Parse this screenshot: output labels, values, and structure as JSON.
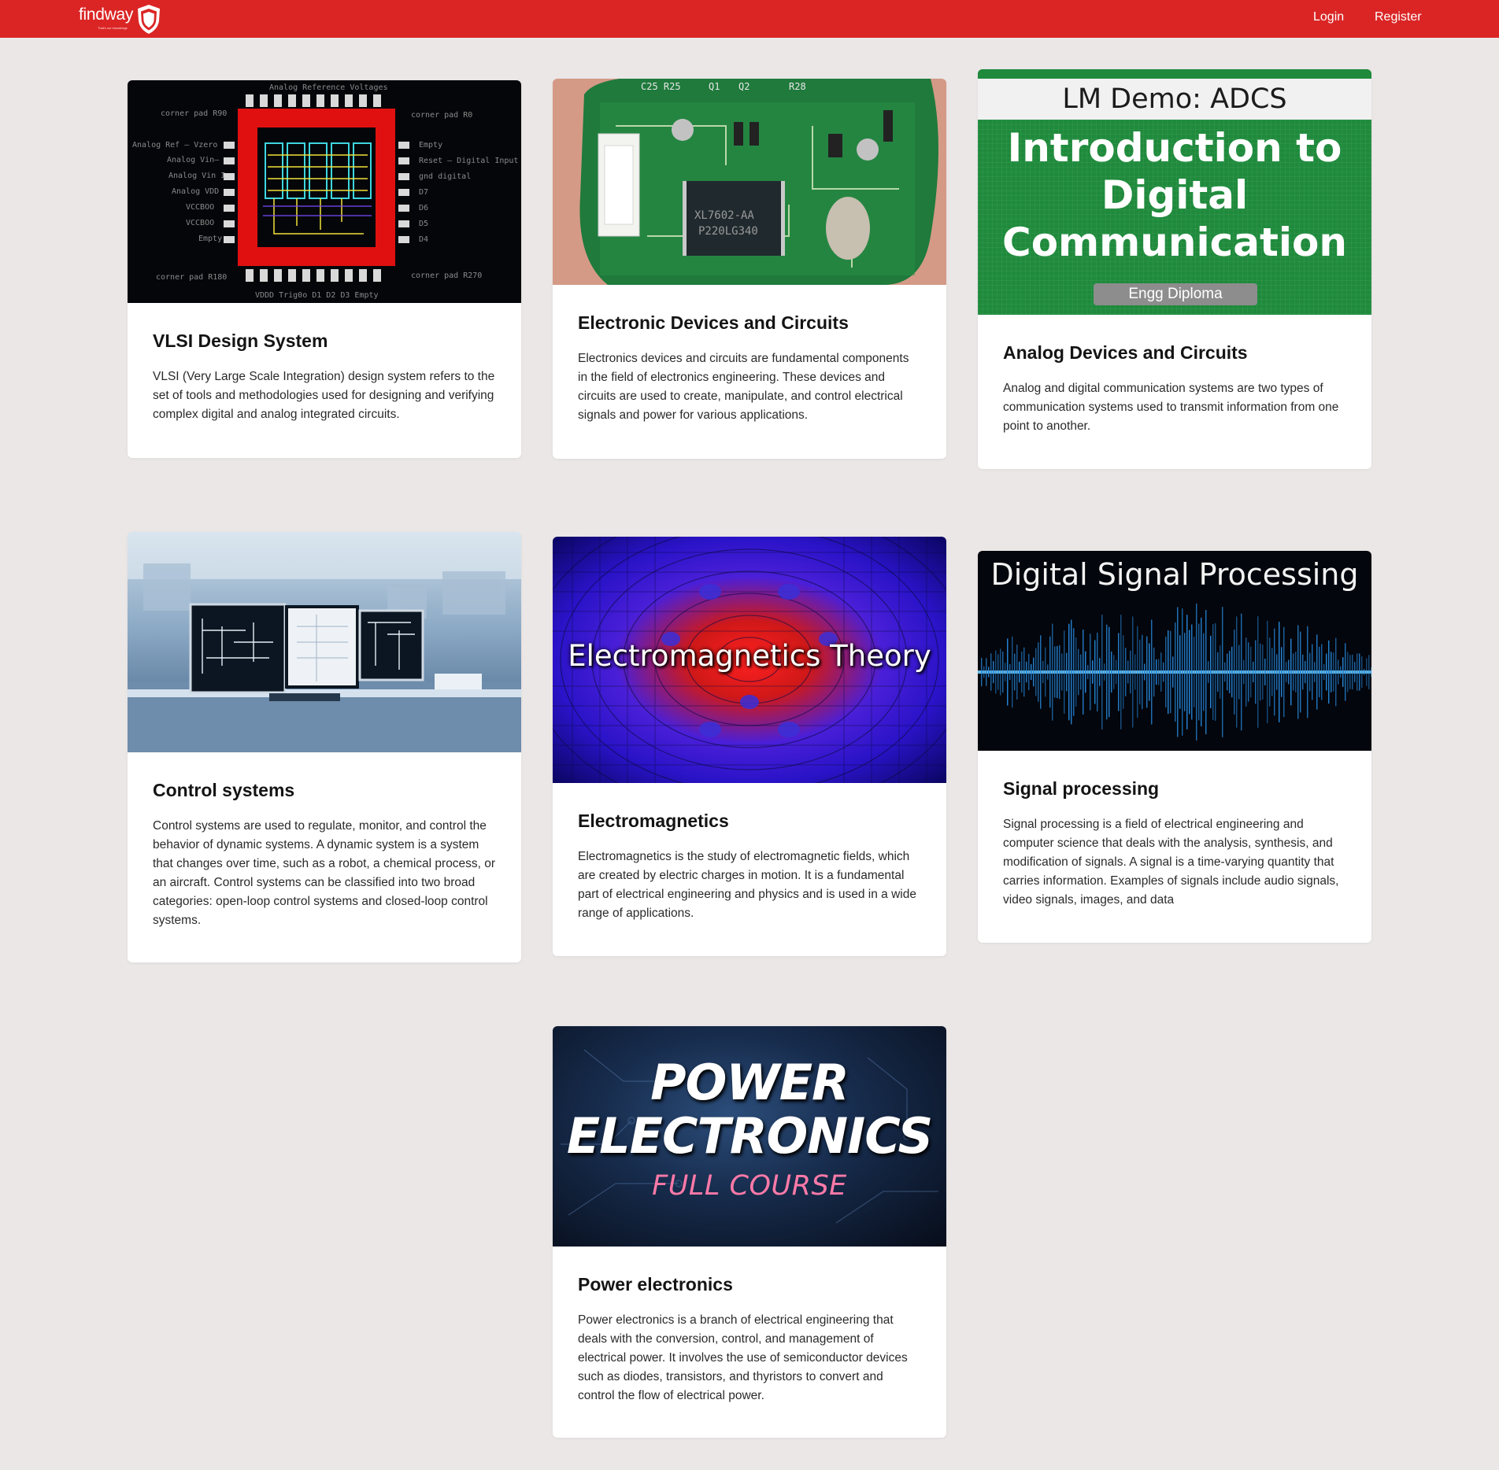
{
  "header": {
    "brand_name": "findway",
    "brand_tagline": "That's our knowledge",
    "login_label": "Login",
    "register_label": "Register"
  },
  "colors": {
    "nav": "#db2525",
    "page_bg": "#ebe7e6",
    "card_bg": "#ffffff"
  },
  "courses": [
    {
      "title": "VLSI Design System",
      "description": "VLSI (Very Large Scale Integration) design system refers to the set of tools and methodologies used for designing and verifying complex digital and analog integrated circuits.",
      "image_label": "vlsi-chip-layout-image"
    },
    {
      "title": "Electronic Devices and Circuits",
      "description": "Electronics devices and circuits are fundamental components in the field of electronics engineering. These devices and circuits are used to create, manipulate, and control electrical signals and power for various applications.",
      "image_label": "circuit-board-image"
    },
    {
      "title": "Analog Devices and Circuits",
      "description": "Analog and digital communication systems are two types of communication systems used to transmit information from one point to another.",
      "image_label": "digital-communication-slide-image",
      "image_texts": {
        "banner": "LM Demo: ADCS",
        "heading_line1": "Introduction to",
        "heading_line2": "Digital",
        "heading_line3": "Communication",
        "badge": "Engg Diploma"
      }
    },
    {
      "title": "Control systems",
      "description": "Control systems are used to regulate, monitor, and control the behavior of dynamic systems. A dynamic system is a system that changes over time, such as a robot, a chemical process, or an aircraft. Control systems can be classified into two broad categories: open-loop control systems and closed-loop control systems.",
      "image_label": "control-room-monitors-image"
    },
    {
      "title": "Electromagnetics",
      "description": "Electromagnetics is the study of electromagnetic fields, which are created by electric charges in motion. It is a fundamental part of electrical engineering and physics and is used in a wide range of applications.",
      "image_label": "electromagnetic-field-image",
      "image_texts": {
        "overlay": "Electromagnetics Theory"
      }
    },
    {
      "title": "Signal processing",
      "description": "Signal processing is a field of electrical engineering and computer science that deals with the analysis, synthesis, and modification of signals. A signal is a time-varying quantity that carries information. Examples of signals include audio signals, video signals, images, and data",
      "image_label": "sound-wave-image",
      "image_texts": {
        "overlay": "Digital Signal Processing"
      }
    },
    {
      "title": "Power electronics",
      "description": "Power electronics is a branch of electrical engineering that deals with the conversion, control, and management of electrical power. It involves the use of semiconductor devices such as diodes, transistors, and thyristors to convert and control the flow of electrical power.",
      "image_label": "power-electronics-course-image",
      "image_texts": {
        "line1": "POWER",
        "line2": "ELECTRONICS",
        "line3": "FULL COURSE"
      }
    }
  ]
}
